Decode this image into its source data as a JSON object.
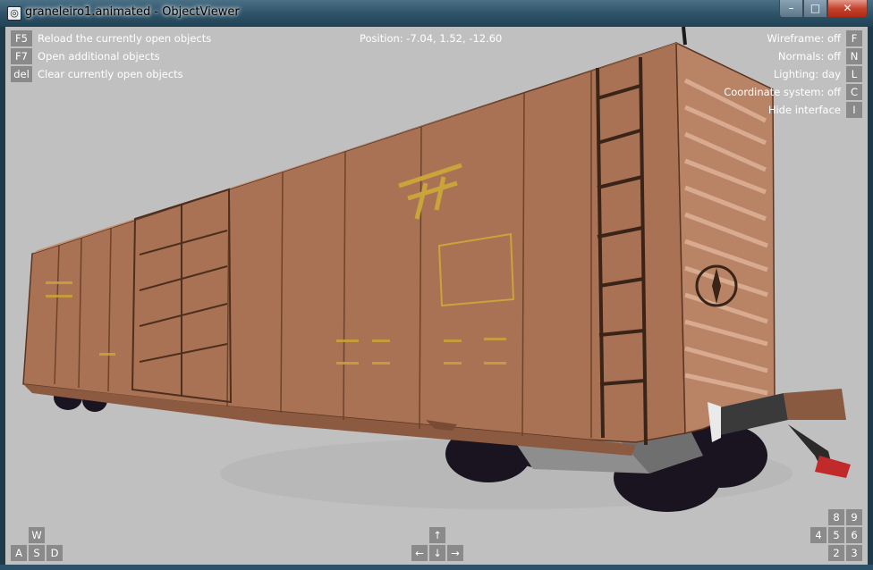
{
  "window": {
    "title": "graneleiro1.animated - ObjectViewer",
    "app_icon": "objectviewer-icon",
    "buttons": {
      "minimize": "–",
      "maximize": "□",
      "close": "✕"
    }
  },
  "hud": {
    "left_commands": [
      {
        "key": "F5",
        "label": "Reload the currently open objects"
      },
      {
        "key": "F7",
        "label": "Open additional objects"
      },
      {
        "key": "del",
        "label": "Clear currently open objects"
      }
    ],
    "position": "Position: -7.04, 1.52, -12.60",
    "right_toggles": [
      {
        "label": "Wireframe: off",
        "key": "F"
      },
      {
        "label": "Normals: off",
        "key": "N"
      },
      {
        "label": "Lighting: day",
        "key": "L"
      },
      {
        "label": "Coordinate system: off",
        "key": "C"
      },
      {
        "label": "Hide interface",
        "key": "I"
      }
    ],
    "wasd": {
      "w": "W",
      "a": "A",
      "s": "S",
      "d": "D"
    },
    "arrows": {
      "up": "↑",
      "left": "←",
      "down": "↓",
      "right": "→"
    },
    "numpad": {
      "n8": "8",
      "n9": "9",
      "n4": "4",
      "n5": "5",
      "n6": "6",
      "n2": "2",
      "n3": "3"
    }
  },
  "colors": {
    "viewport_bg": "#c0c0c0",
    "car_body": "#a97254",
    "car_dark": "#8b5a40",
    "key_bg": "#8a8a8a"
  }
}
